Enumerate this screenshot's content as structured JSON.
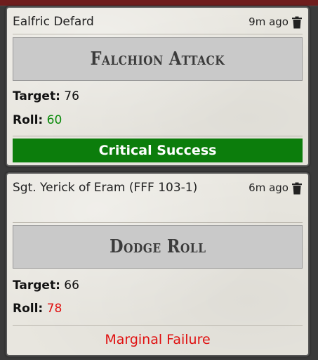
{
  "messages": [
    {
      "sender": "Ealfric Defard",
      "timestamp": "9m ago",
      "delete_icon": "trash-icon",
      "title": "Falchion Attack",
      "target_label": "Target:",
      "target_value": "76",
      "roll_label": "Roll:",
      "roll_value": "60",
      "roll_color": "#0a8a0a",
      "result": "Critical Success",
      "result_style": "green-banner"
    },
    {
      "sender": "Sgt. Yerick of Eram (FFF 103-1)",
      "timestamp": "6m ago",
      "delete_icon": "trash-icon",
      "title": "Dodge Roll",
      "target_label": "Target:",
      "target_value": "66",
      "roll_label": "Roll:",
      "roll_value": "78",
      "roll_color": "#e01010",
      "result": "Marginal Failure",
      "result_style": "red-text"
    }
  ],
  "colors": {
    "success_banner": "#0c7d0c",
    "failure_text": "#e01010",
    "card_background": "#e8e6df",
    "title_box": "#c9c9c9"
  }
}
